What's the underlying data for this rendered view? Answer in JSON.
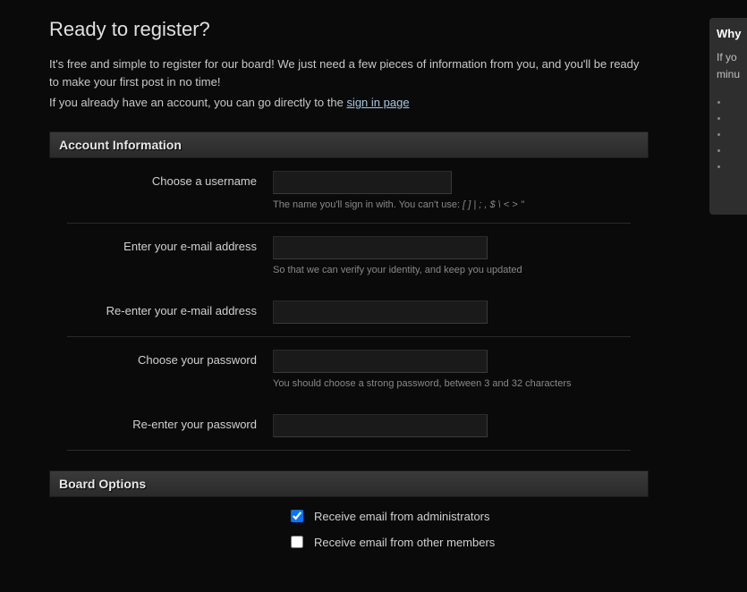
{
  "page": {
    "title": "Ready to register?",
    "intro1": "It's free and simple to register for our board! We just need a few pieces of information from you, and you'll be ready to make your first post in no time!",
    "intro2_prefix": "If you already have an account, you can go directly to the ",
    "signin_link": "sign in page"
  },
  "sections": {
    "account": "Account Information",
    "board_options": "Board Options"
  },
  "fields": {
    "username": {
      "label": "Choose a username",
      "help_prefix": "The name you'll sign in with. You can't use: ",
      "help_chars": "[ ] | ; , $ \\ < > \""
    },
    "email": {
      "label": "Enter your e-mail address",
      "help": "So that we can verify your identity, and keep you updated"
    },
    "email_confirm": {
      "label": "Re-enter your e-mail address"
    },
    "password": {
      "label": "Choose your password",
      "help": "You should choose a strong password, between 3 and 32 characters"
    },
    "password_confirm": {
      "label": "Re-enter your password"
    }
  },
  "options": {
    "admin_email": {
      "label": "Receive email from administrators",
      "checked": true
    },
    "member_email": {
      "label": "Receive email from other members",
      "checked": false
    }
  },
  "sidebar": {
    "title": "Why",
    "text1": "If yo",
    "text2": "minu"
  }
}
